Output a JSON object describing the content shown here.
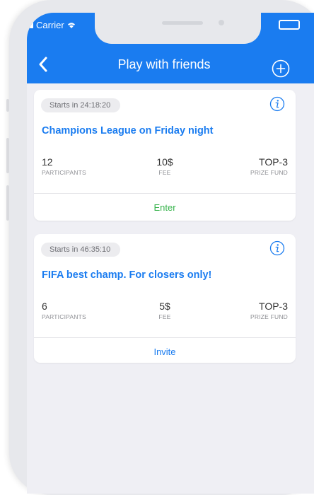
{
  "status_bar": {
    "carrier": "Carrier"
  },
  "header": {
    "title": "Play with friends",
    "back_icon": "chevron-left-icon",
    "add_icon": "plus-circle-icon"
  },
  "colors": {
    "accent": "#1a7cf0",
    "enter": "#35b34a",
    "background": "#efeff4"
  },
  "tournaments": [
    {
      "starts": "Starts in 24:18:20",
      "title": "Champions League on Friday night",
      "participants": {
        "value": "12",
        "label": "PARTICIPANTS"
      },
      "fee": {
        "value": "10$",
        "label": "FEE"
      },
      "prize": {
        "value": "TOP-3",
        "label": "PRIZE FUND"
      },
      "action": "Enter"
    },
    {
      "starts": "Starts in 46:35:10",
      "title": "FIFA best champ. For closers only!",
      "participants": {
        "value": "6",
        "label": "PARTICIPANTS"
      },
      "fee": {
        "value": "5$",
        "label": "FEE"
      },
      "prize": {
        "value": "TOP-3",
        "label": "PRIZE FUND"
      },
      "action": "Invite"
    }
  ]
}
